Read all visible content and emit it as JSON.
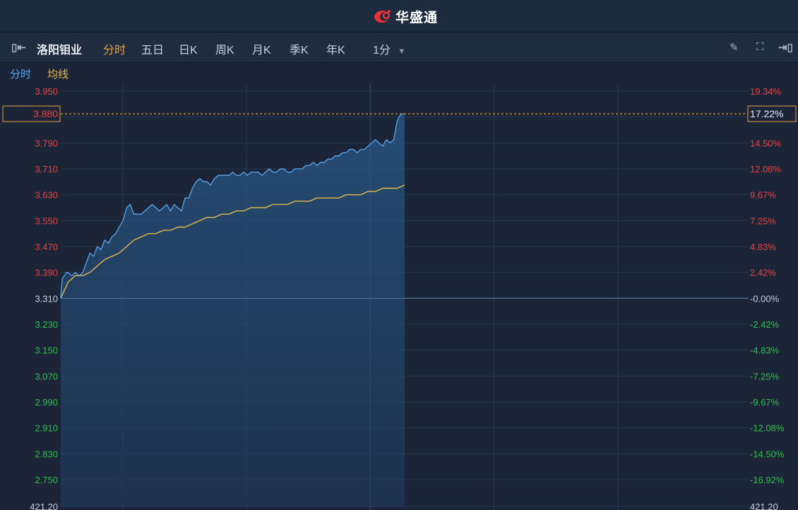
{
  "brand": {
    "logo_icon": "huashengtong-logo-icon",
    "name": "华盛通"
  },
  "toolbar": {
    "collapse_icon": "collapse-panel-icon",
    "stock_name": "洛阳钼业",
    "periods": [
      "分时",
      "五日",
      "日K",
      "周K",
      "月K",
      "季K",
      "年K"
    ],
    "active_period": "分时",
    "interval": "1分",
    "interval_icon": "chevron-down-icon",
    "right_icons": [
      "pencil-icon",
      "fullscreen-icon",
      "expand-panel-icon"
    ]
  },
  "subbar": {
    "label1": "分时",
    "label2": "均线"
  },
  "colors": {
    "price_line": "#5aa7ef",
    "avg_line": "#e6b84a",
    "up": "#e84242",
    "down": "#2fbf4f",
    "neutral": "#c8d0dc",
    "highlight": "#e8a33c"
  },
  "chart_data": {
    "type": "line",
    "ylim": [
      2.75,
      3.95
    ],
    "prev_close": 3.31,
    "current_price": "3.880",
    "current_change": "17.22%",
    "left_ticks": [
      "3.950",
      "3.790",
      "3.710",
      "3.630",
      "3.550",
      "3.470",
      "3.390",
      "3.310",
      "3.230",
      "3.150",
      "3.070",
      "2.990",
      "2.910",
      "2.830",
      "2.750",
      "421.20"
    ],
    "right_ticks": [
      "19.34%",
      "14.50%",
      "12.08%",
      "9.67%",
      "7.25%",
      "4.83%",
      "2.42%",
      "-0.00%",
      "-2.42%",
      "-4.83%",
      "-7.25%",
      "-9.67%",
      "-12.08%",
      "-14.50%",
      "-16.92%",
      "421.20"
    ],
    "series": [
      {
        "name": "分时",
        "x": [
          0,
          2,
          5,
          8,
          10,
          15,
          20,
          25,
          30,
          35,
          40,
          45,
          50,
          55,
          60,
          65,
          70,
          75,
          80,
          85,
          90,
          95,
          100,
          105,
          110,
          115,
          120,
          125,
          130,
          135,
          140,
          145,
          150,
          155,
          160,
          165,
          170,
          175,
          180,
          185,
          190,
          195,
          200,
          205,
          210,
          215,
          220,
          225,
          230,
          235,
          240,
          245,
          250,
          255,
          260,
          265,
          270,
          275,
          280,
          285,
          290,
          295,
          300,
          305,
          310,
          315,
          320,
          325,
          330,
          335,
          340,
          345,
          350,
          355,
          360,
          365,
          370,
          375,
          380,
          385,
          390,
          395,
          400,
          405,
          410,
          415,
          420,
          425,
          430,
          435,
          440,
          445,
          450,
          455,
          460,
          465,
          470
        ],
        "values": [
          3.31,
          3.37,
          3.38,
          3.39,
          3.39,
          3.38,
          3.39,
          3.38,
          3.39,
          3.42,
          3.45,
          3.44,
          3.47,
          3.46,
          3.49,
          3.48,
          3.5,
          3.51,
          3.53,
          3.55,
          3.59,
          3.6,
          3.57,
          3.57,
          3.57,
          3.58,
          3.59,
          3.6,
          3.59,
          3.58,
          3.59,
          3.6,
          3.58,
          3.6,
          3.59,
          3.58,
          3.62,
          3.62,
          3.65,
          3.67,
          3.68,
          3.67,
          3.67,
          3.66,
          3.68,
          3.69,
          3.69,
          3.69,
          3.69,
          3.7,
          3.69,
          3.69,
          3.7,
          3.69,
          3.7,
          3.7,
          3.7,
          3.69,
          3.7,
          3.71,
          3.7,
          3.7,
          3.71,
          3.71,
          3.7,
          3.7,
          3.71,
          3.71,
          3.71,
          3.72,
          3.72,
          3.73,
          3.72,
          3.73,
          3.73,
          3.74,
          3.74,
          3.75,
          3.75,
          3.76,
          3.76,
          3.77,
          3.77,
          3.76,
          3.77,
          3.77,
          3.78,
          3.79,
          3.8,
          3.79,
          3.78,
          3.8,
          3.79,
          3.8,
          3.86,
          3.88,
          3.88
        ]
      },
      {
        "name": "均线",
        "x": [
          0,
          10,
          20,
          30,
          40,
          50,
          60,
          70,
          80,
          90,
          100,
          110,
          120,
          130,
          140,
          150,
          160,
          170,
          180,
          190,
          200,
          210,
          220,
          230,
          240,
          250,
          260,
          270,
          280,
          290,
          300,
          310,
          320,
          330,
          340,
          350,
          360,
          370,
          380,
          390,
          400,
          410,
          420,
          430,
          440,
          450,
          460,
          470
        ],
        "values": [
          3.31,
          3.36,
          3.38,
          3.38,
          3.39,
          3.41,
          3.43,
          3.44,
          3.45,
          3.47,
          3.49,
          3.5,
          3.51,
          3.51,
          3.52,
          3.52,
          3.53,
          3.53,
          3.54,
          3.55,
          3.56,
          3.56,
          3.57,
          3.57,
          3.58,
          3.58,
          3.59,
          3.59,
          3.59,
          3.6,
          3.6,
          3.6,
          3.61,
          3.61,
          3.61,
          3.62,
          3.62,
          3.62,
          3.62,
          3.63,
          3.63,
          3.63,
          3.64,
          3.64,
          3.65,
          3.65,
          3.65,
          3.66
        ]
      }
    ]
  }
}
